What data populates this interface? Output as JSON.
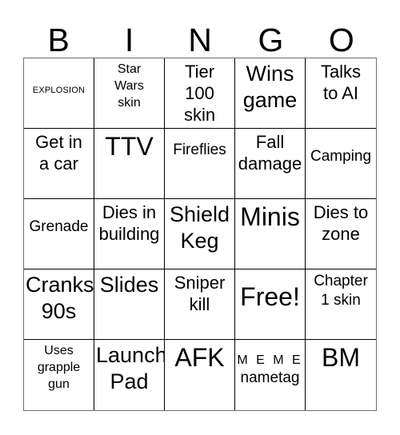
{
  "header": {
    "letters": [
      "B",
      "I",
      "N",
      "G",
      "O"
    ]
  },
  "grid": {
    "rows": [
      [
        {
          "text": "EXPLOSION",
          "size": "s-xs"
        },
        {
          "text": "Star\nWars\nskin",
          "size": "s-sm"
        },
        {
          "text": "Tier\n100\nskin",
          "size": "s-lg"
        },
        {
          "text": "Wins\ngame",
          "size": "s-xl"
        },
        {
          "text": "Talks\nto AI",
          "size": "s-lg"
        }
      ],
      [
        {
          "text": "Get in\na car",
          "size": "s-lg"
        },
        {
          "text": "TTV",
          "size": "s-xxl"
        },
        {
          "text": "Fireflies",
          "size": "s-md",
          "pad": "pad-1"
        },
        {
          "text": "Fall\ndamage",
          "size": "s-lg"
        },
        {
          "text": "Camping",
          "size": "s-md",
          "pad": "pad-2"
        }
      ],
      [
        {
          "text": "Grenade",
          "size": "s-md",
          "pad": "pad-2"
        },
        {
          "text": "Dies in\nbuilding",
          "size": "s-lg"
        },
        {
          "text": "Shield\nKeg",
          "size": "s-xl"
        },
        {
          "text": "Minis",
          "size": "s-xxl"
        },
        {
          "text": "Dies to\nzone",
          "size": "s-lg"
        }
      ],
      [
        {
          "text": "Cranks\n90s",
          "size": "s-xl"
        },
        {
          "text": "Slides",
          "size": "s-xl"
        },
        {
          "text": "Sniper\nkill",
          "size": "s-lg"
        },
        {
          "text": "Free!",
          "size": "s-xxl",
          "pad": "pad-1"
        },
        {
          "text": "Chapter\n1 skin",
          "size": "s-md"
        }
      ],
      [
        {
          "text": "Uses\ngrapple\ngun",
          "size": "s-sm"
        },
        {
          "text": "Launch\nPad",
          "size": "s-xl"
        },
        {
          "text": "AFK",
          "size": "s-xxl"
        },
        {
          "two_part": true,
          "part_a": "M E M E",
          "part_b": "nametag",
          "pad": "pad-1"
        },
        {
          "text": "BM",
          "size": "s-xxl"
        }
      ]
    ]
  },
  "colors": {
    "background": "#ffffff",
    "text": "#000000",
    "cell_border": "#000000",
    "outer_border": "#6e6e6e"
  }
}
